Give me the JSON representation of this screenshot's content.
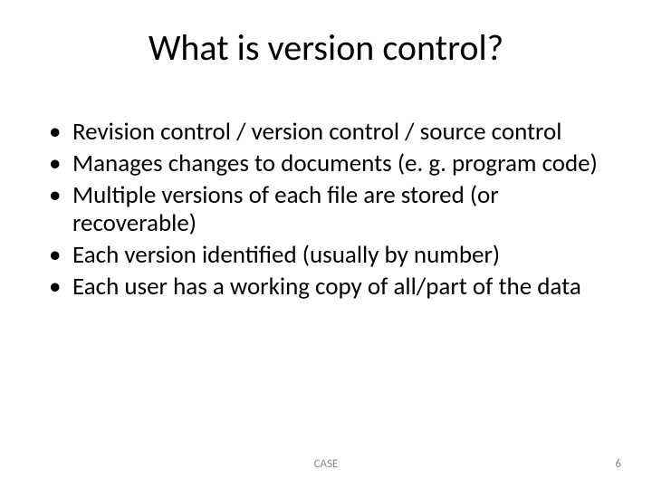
{
  "slide": {
    "title": "What is version control?",
    "bullets": [
      "Revision control / version control / source control",
      "Manages changes to documents (e. g. program code)",
      "Multiple versions of each file are stored (or recoverable)",
      "Each version identified (usually by number)",
      "Each user has a working copy of all/part of the data"
    ],
    "footer_label": "CASE",
    "page_number": "6"
  }
}
